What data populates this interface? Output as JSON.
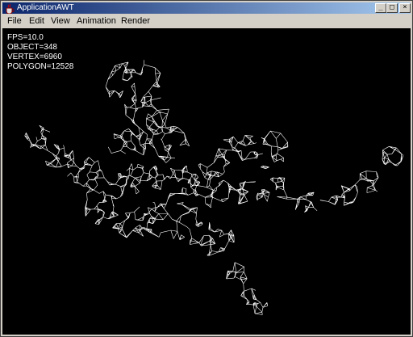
{
  "window": {
    "title": "ApplicationAWT",
    "minimize_glyph": "_",
    "maximize_glyph": "□",
    "close_glyph": "×"
  },
  "menu": [
    "File",
    "Edit",
    "View",
    "Animation",
    "Render"
  ],
  "stats": {
    "fps": "FPS=10.0",
    "object": "OBJECT=348",
    "vertex": "VERTEX=6960",
    "polygon": "POLYGON=12528"
  },
  "colors": {
    "titlebar_start": "#0a246a",
    "titlebar_end": "#a6caf0",
    "canvas_bg": "#000000",
    "wireframe": "#ffffff"
  },
  "icons": {
    "app": "java-cup-icon"
  }
}
